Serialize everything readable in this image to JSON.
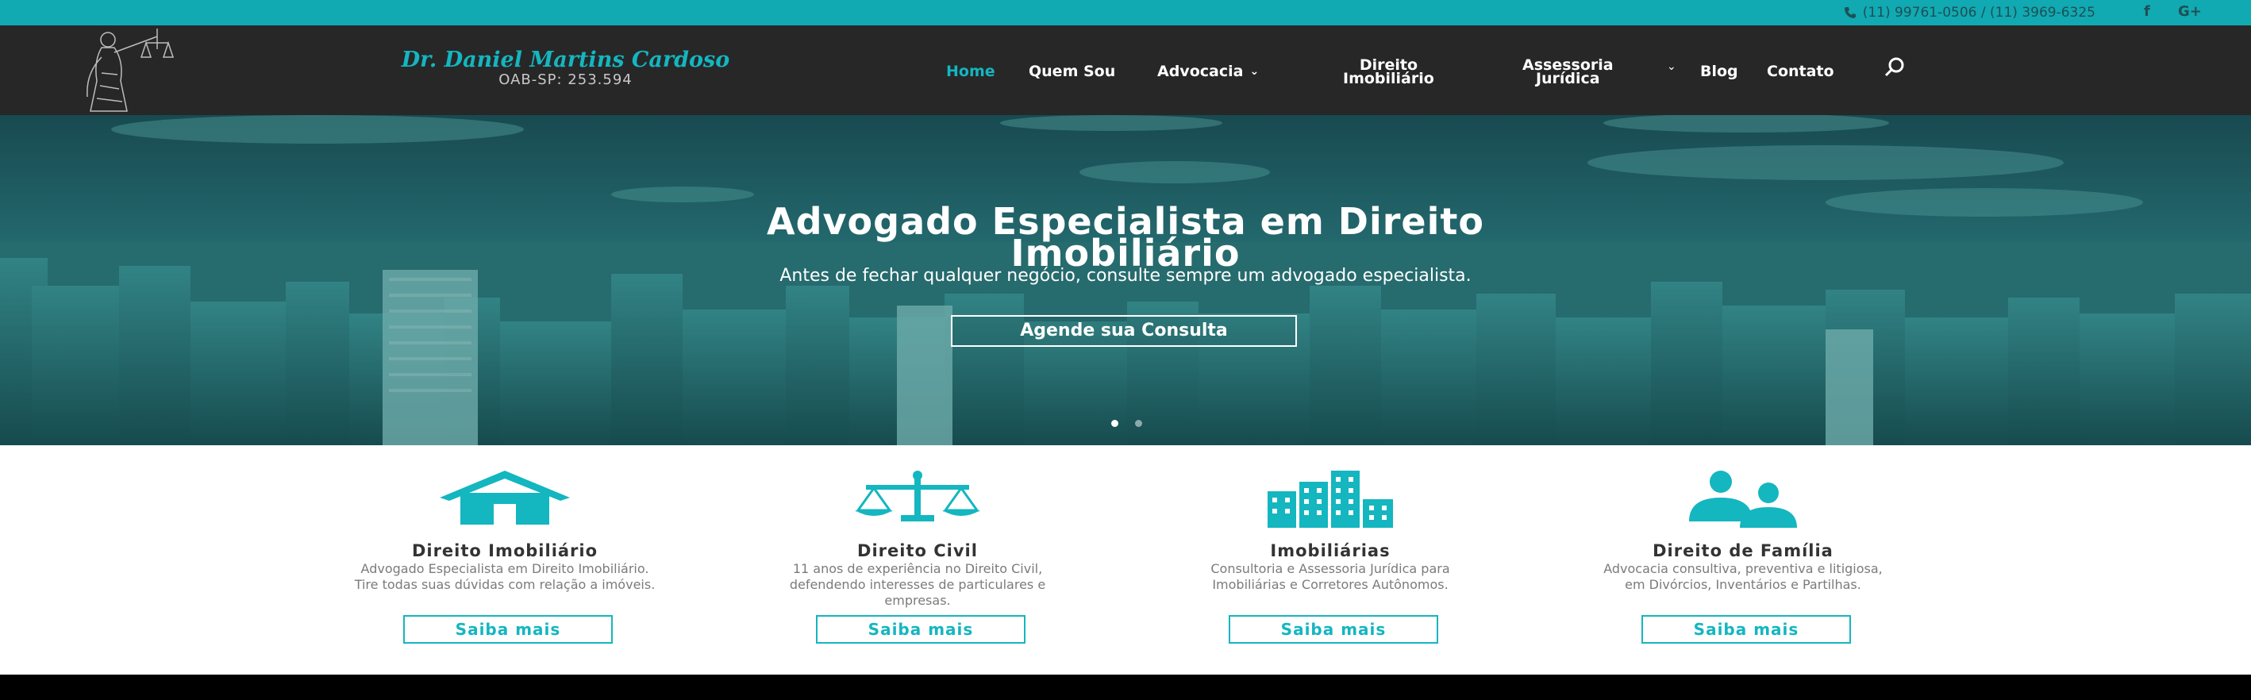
{
  "topbar": {
    "phones": "(11) 99761-0506 / (11) 3969-6325",
    "social": [
      {
        "icon": "facebook-icon",
        "label": "f"
      },
      {
        "icon": "google-plus-icon",
        "label": "G+"
      }
    ]
  },
  "brand": {
    "name": "Dr. Daniel Martins Cardoso",
    "oab": "OAB-SP: 253.594"
  },
  "nav": {
    "items": [
      {
        "label": "Home"
      },
      {
        "label": "Quem Sou"
      },
      {
        "label": "Advocacia"
      },
      {
        "label": "Direito\nImobiliário"
      },
      {
        "label": "Assessoria\nJurídica"
      },
      {
        "label": "Blog"
      },
      {
        "label": "Contato"
      }
    ]
  },
  "hero": {
    "title_line1": "Advogado Especialista em Direito",
    "title_line2": "Imobiliário",
    "subtitle": "Antes de fechar qualquer negócio, consulte sempre um advogado especialista.",
    "cta": "Agende sua Consulta",
    "slides_total": 2,
    "slide_active": 1
  },
  "services": [
    {
      "icon": "house-icon",
      "title": "Direito Imobiliário",
      "desc": "Advogado Especialista em Direito Imobiliário. Tire todas suas dúvidas com relação a imóveis.",
      "button": "Saiba mais"
    },
    {
      "icon": "scales-icon",
      "title": "Direito Civil",
      "desc": "11 anos de experiência no Direito Civil, defendendo interesses de particulares e empresas.",
      "button": "Saiba mais"
    },
    {
      "icon": "buildings-icon",
      "title": "Imobiliárias",
      "desc": "Consultoria e Assessoria Jurídica para Imobiliárias e Corretores Autônomos.",
      "button": "Saiba mais"
    },
    {
      "icon": "family-icon",
      "title": "Direito de Família",
      "desc": "Advocacia consultiva, preventiva e litigiosa, em Divórcios, Inventários e Partilhas.",
      "button": "Saiba mais"
    }
  ],
  "colors": {
    "accent": "#14b6c0",
    "topbar": "#11a9b2",
    "header": "#272727",
    "hero_overlay": "#1a5e63"
  }
}
